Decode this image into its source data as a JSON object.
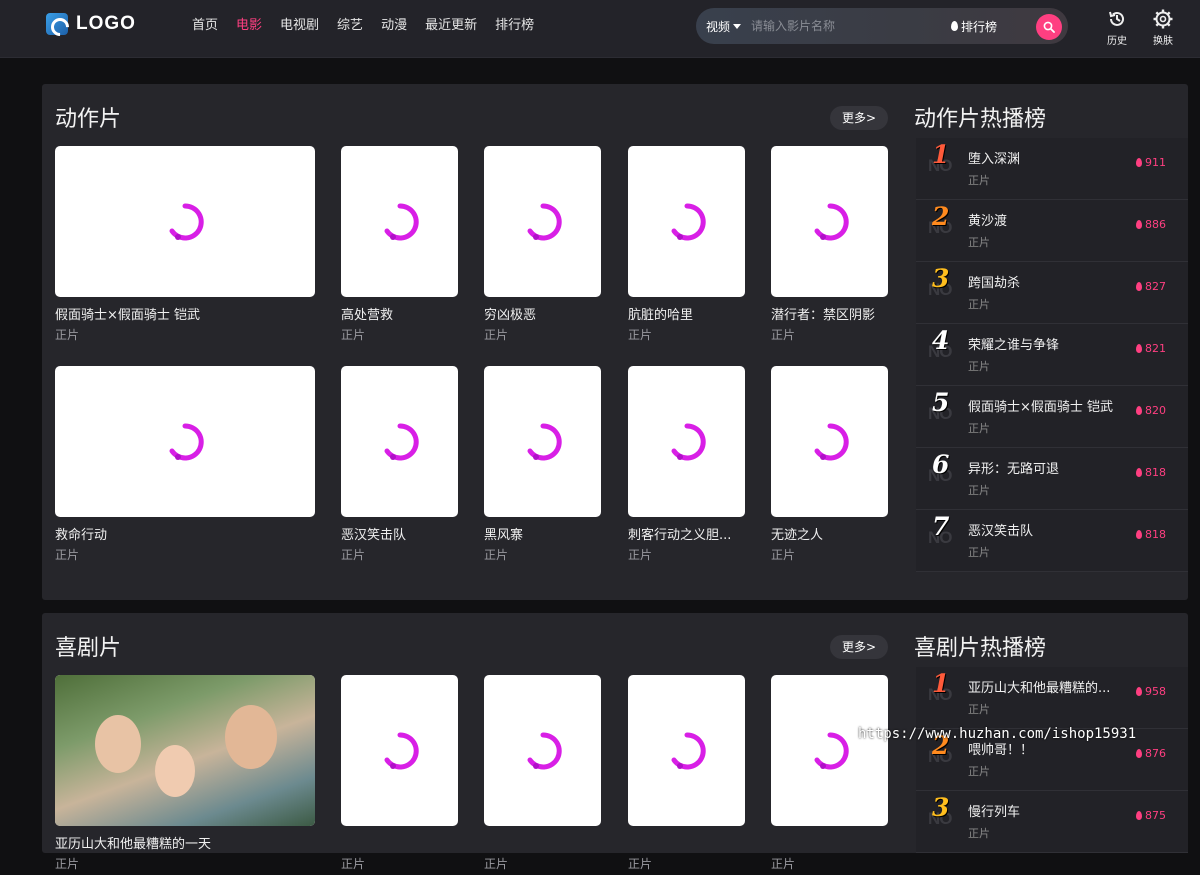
{
  "header": {
    "logo_text": "LOGO",
    "nav": [
      {
        "label": "首页",
        "active": false
      },
      {
        "label": "电影",
        "active": true
      },
      {
        "label": "电视剧",
        "active": false
      },
      {
        "label": "综艺",
        "active": false
      },
      {
        "label": "动漫",
        "active": false
      },
      {
        "label": "最近更新",
        "active": false
      },
      {
        "label": "排行榜",
        "active": false
      }
    ],
    "search": {
      "type_label": "视频",
      "placeholder": "请输入影片名称",
      "rank_label": "排行榜"
    },
    "history_label": "历史",
    "skin_label": "换肤",
    "accent_color": "#ff3f81"
  },
  "sections": [
    {
      "title": "动作片",
      "more_label": "更多>",
      "rank_title": "动作片热播榜",
      "cards": [
        {
          "title": "假面骑士×假面骑士 铠武",
          "sub": "正片",
          "image": "loading"
        },
        {
          "title": "高处营救",
          "sub": "正片",
          "image": "loading"
        },
        {
          "title": "穷凶极恶",
          "sub": "正片",
          "image": "loading"
        },
        {
          "title": "肮脏的哈里",
          "sub": "正片",
          "image": "loading"
        },
        {
          "title": "潜行者：禁区阴影",
          "sub": "正片",
          "image": "loading"
        },
        {
          "title": "救命行动",
          "sub": "正片",
          "image": "loading"
        },
        {
          "title": "恶汉笑击队",
          "sub": "正片",
          "image": "loading"
        },
        {
          "title": "黑风寨",
          "sub": "正片",
          "image": "loading"
        },
        {
          "title": "刺客行动之义胆...",
          "sub": "正片",
          "image": "loading"
        },
        {
          "title": "无迹之人",
          "sub": "正片",
          "image": "loading"
        }
      ],
      "rank": [
        {
          "num": "1",
          "no": "NO",
          "name": "堕入深渊",
          "sub": "正片",
          "heat": "911"
        },
        {
          "num": "2",
          "no": "NO",
          "name": "黄沙渡",
          "sub": "正片",
          "heat": "886"
        },
        {
          "num": "3",
          "no": "NO",
          "name": "跨国劫杀",
          "sub": "正片",
          "heat": "827"
        },
        {
          "num": "4",
          "no": "NO",
          "name": "荣耀之谁与争锋",
          "sub": "正片",
          "heat": "821"
        },
        {
          "num": "5",
          "no": "NO",
          "name": "假面骑士×假面骑士 铠武",
          "sub": "正片",
          "heat": "820"
        },
        {
          "num": "6",
          "no": "NO",
          "name": "异形：无路可退",
          "sub": "正片",
          "heat": "818"
        },
        {
          "num": "7",
          "no": "NO",
          "name": "恶汉笑击队",
          "sub": "正片",
          "heat": "818"
        }
      ]
    },
    {
      "title": "喜剧片",
      "more_label": "更多>",
      "rank_title": "喜剧片热播榜",
      "cards": [
        {
          "title": "亚历山大和他最糟糕的一天",
          "sub": "正片",
          "image": "photo"
        },
        {
          "title": "",
          "sub": "正片",
          "image": "loading"
        },
        {
          "title": "",
          "sub": "正片",
          "image": "loading"
        },
        {
          "title": "",
          "sub": "正片",
          "image": "loading"
        },
        {
          "title": "",
          "sub": "正片",
          "image": "loading"
        }
      ],
      "rank": [
        {
          "num": "1",
          "no": "NO",
          "name": "亚历山大和他最糟糕的...",
          "sub": "正片",
          "heat": "958"
        },
        {
          "num": "2",
          "no": "NO",
          "name": "喂帅哥！！",
          "sub": "正片",
          "heat": "876"
        },
        {
          "num": "3",
          "no": "NO",
          "name": "慢行列车",
          "sub": "正片",
          "heat": "875"
        }
      ]
    }
  ],
  "watermark": "https://www.huzhan.com/ishop15931"
}
